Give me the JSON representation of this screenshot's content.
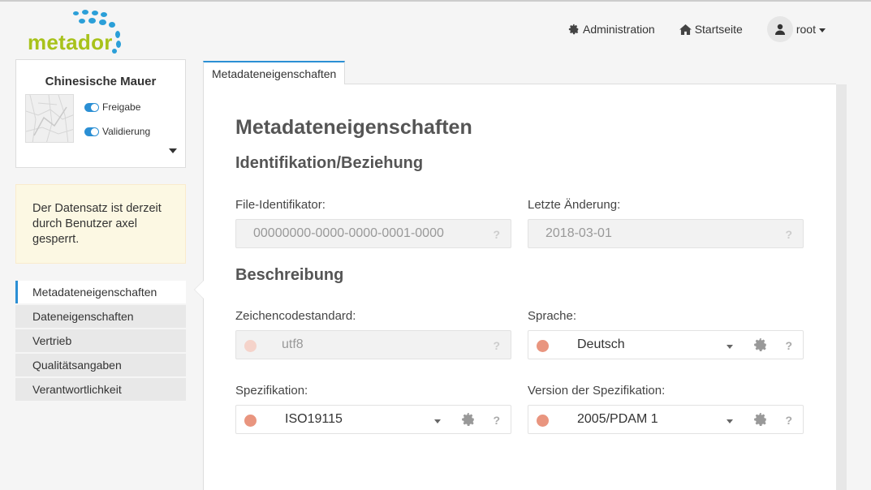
{
  "header": {
    "logo_text": "metador",
    "nav": {
      "administration": "Administration",
      "home": "Startseite",
      "user": "root"
    }
  },
  "sidebar": {
    "dataset_title": "Chinesische Mauer",
    "toggles": [
      {
        "label": "Freigabe",
        "on": true
      },
      {
        "label": "Validierung",
        "on": true
      }
    ],
    "lock_message": "Der Datensatz ist derzeit durch Benutzer axel gesperrt.",
    "menu": [
      {
        "label": "Metadateneigenschaften",
        "active": true
      },
      {
        "label": "Dateneigenschaften",
        "active": false
      },
      {
        "label": "Vertrieb",
        "active": false
      },
      {
        "label": "Qualitätsangaben",
        "active": false
      },
      {
        "label": "Verantwortlichkeit",
        "active": false
      }
    ]
  },
  "main": {
    "tab_label": "Metadateneigenschaften",
    "title": "Metadateneigenschaften",
    "section_identification": "Identifikation/Beziehung",
    "section_description": "Beschreibung",
    "fields": {
      "file_identifier": {
        "label": "File-Identifikator:",
        "value": "00000000-0000-0000-0001-0000"
      },
      "last_change": {
        "label": "Letzte Änderung:",
        "value": "2018-03-01"
      },
      "charset": {
        "label": "Zeichencodestandard:",
        "value": "utf8"
      },
      "language": {
        "label": "Sprache:",
        "value": "Deutsch"
      },
      "specification": {
        "label": "Spezifikation:",
        "value": "ISO19115"
      },
      "spec_version": {
        "label": "Version der Spezifikation:",
        "value": "2005/PDAM 1"
      }
    },
    "help_glyph": "?"
  },
  "colors": {
    "accent": "#2b8fd4",
    "logo_green": "#a8c21b",
    "required_dot": "#e9957f",
    "alert_bg": "#fcf8e3"
  }
}
